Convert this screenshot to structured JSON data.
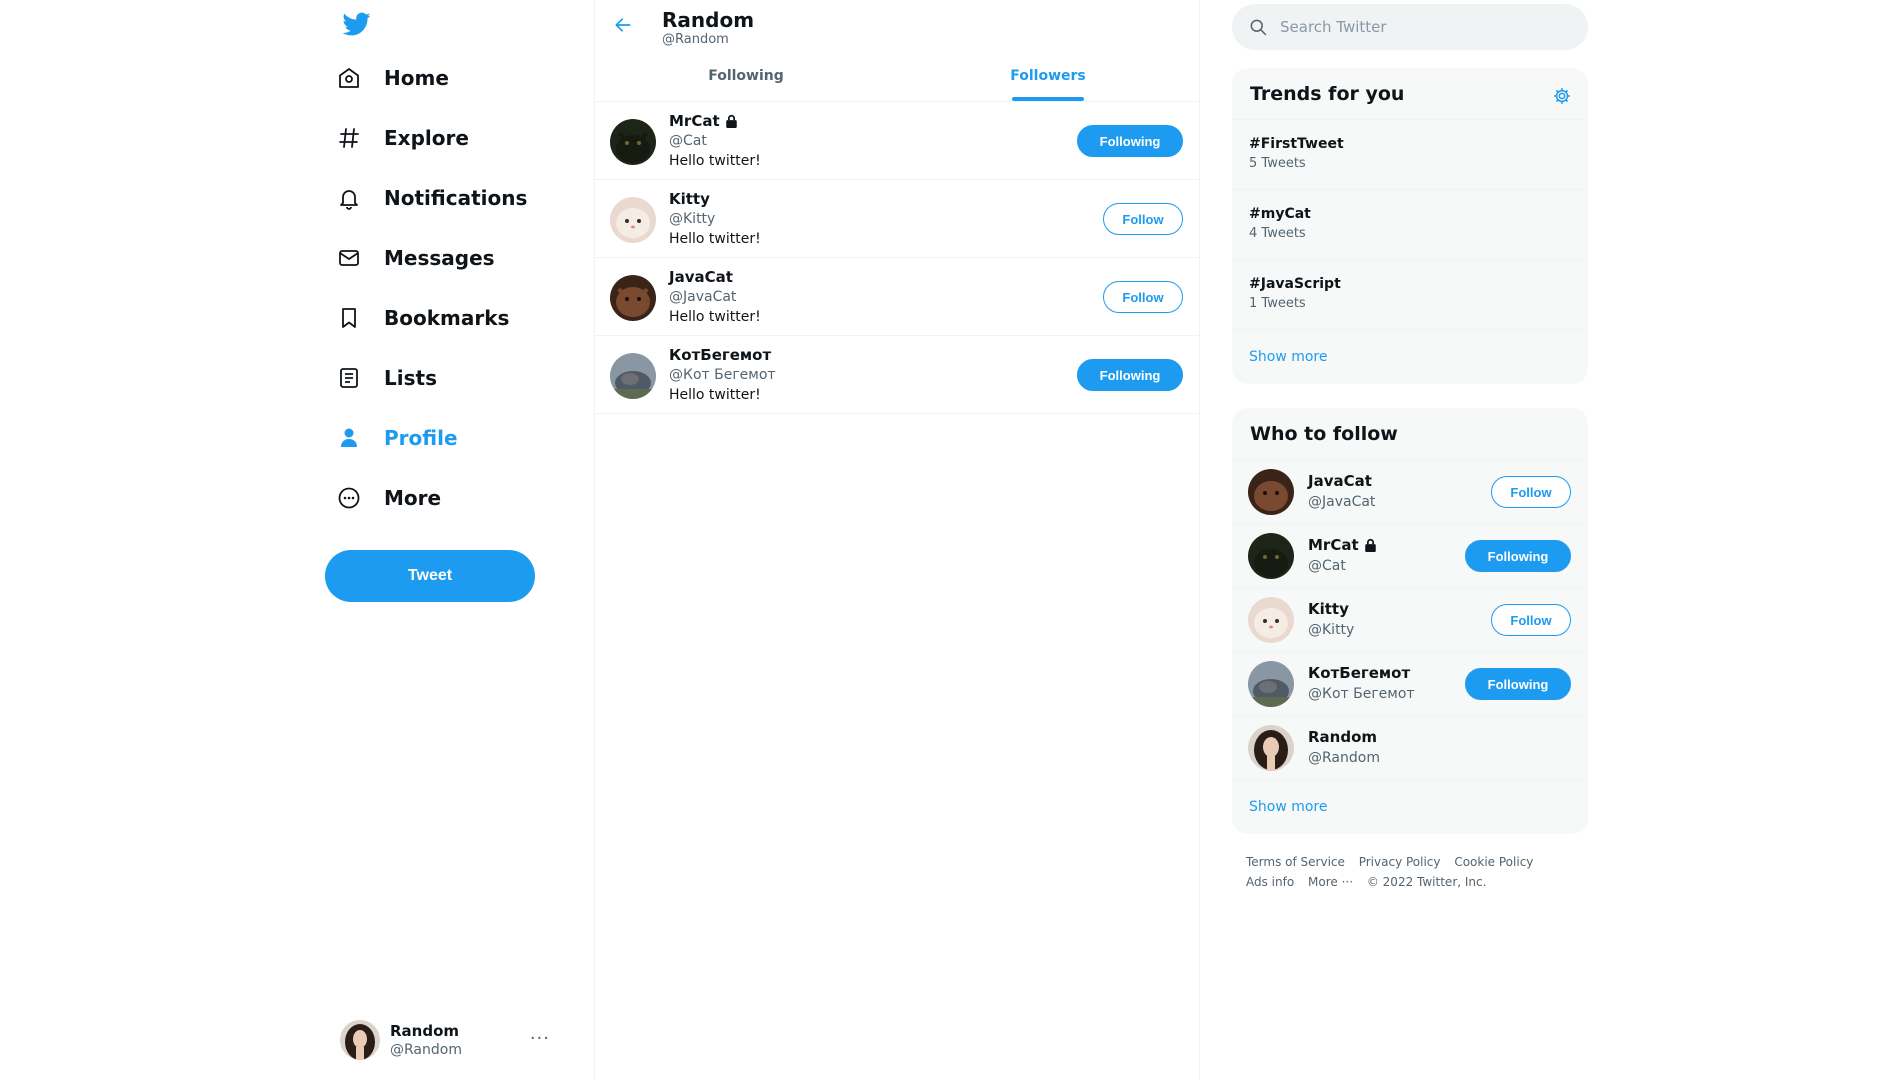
{
  "sidebar": {
    "logo": "twitter-bird-icon",
    "nav": [
      {
        "label": "Home",
        "icon": "home-icon"
      },
      {
        "label": "Explore",
        "icon": "hashtag-icon"
      },
      {
        "label": "Notifications",
        "icon": "bell-icon"
      },
      {
        "label": "Messages",
        "icon": "envelope-icon"
      },
      {
        "label": "Bookmarks",
        "icon": "bookmark-icon"
      },
      {
        "label": "Lists",
        "icon": "list-icon"
      },
      {
        "label": "Profile",
        "icon": "person-icon",
        "active": true
      },
      {
        "label": "More",
        "icon": "more-circle-icon"
      }
    ],
    "tweet_button": "Tweet",
    "account": {
      "name": "Random",
      "handle": "@Random",
      "more": "···"
    }
  },
  "main": {
    "header": {
      "name": "Random",
      "handle": "@Random"
    },
    "tabs": [
      {
        "label": "Following",
        "active": false
      },
      {
        "label": "Followers",
        "active": true
      }
    ],
    "users": [
      {
        "name": "MrCat",
        "locked": true,
        "handle": "@Cat",
        "bio": "Hello twitter!",
        "button": "Following"
      },
      {
        "name": "Kitty",
        "locked": false,
        "handle": "@Kitty",
        "bio": "Hello twitter!",
        "button": "Follow"
      },
      {
        "name": "JavaCat",
        "locked": false,
        "handle": "@JavaCat",
        "bio": "Hello twitter!",
        "button": "Follow"
      },
      {
        "name": "КотБегемот",
        "locked": false,
        "handle": "@Кот Бегемот",
        "bio": "Hello twitter!",
        "button": "Following"
      }
    ]
  },
  "right": {
    "search": {
      "placeholder": "Search Twitter"
    },
    "trends": {
      "title": "Trends for you",
      "items": [
        {
          "tag": "#FirstTweet",
          "count": "5 Tweets"
        },
        {
          "tag": "#myCat",
          "count": "4 Tweets"
        },
        {
          "tag": "#JavaScript",
          "count": "1 Tweets"
        }
      ],
      "show_more": "Show more"
    },
    "who_to_follow": {
      "title": "Who to follow",
      "items": [
        {
          "name": "JavaCat",
          "locked": false,
          "handle": "@JavaCat",
          "button": "Follow"
        },
        {
          "name": "MrCat",
          "locked": true,
          "handle": "@Cat",
          "button": "Following"
        },
        {
          "name": "Kitty",
          "locked": false,
          "handle": "@Kitty",
          "button": "Follow"
        },
        {
          "name": "КотБегемот",
          "locked": false,
          "handle": "@Кот Бегемот",
          "button": "Following"
        },
        {
          "name": "Random",
          "locked": false,
          "handle": "@Random",
          "button": ""
        }
      ],
      "show_more": "Show more"
    },
    "footer": {
      "terms": "Terms of Service",
      "privacy": "Privacy Policy",
      "cookie": "Cookie Policy",
      "ads": "Ads info",
      "more": "More ···",
      "copyright": "© 2022 Twitter, Inc."
    }
  },
  "colors": {
    "accent": "#1d9bf0",
    "text": "#0f1419",
    "muted": "#536471",
    "panel": "#f7f9f9"
  }
}
